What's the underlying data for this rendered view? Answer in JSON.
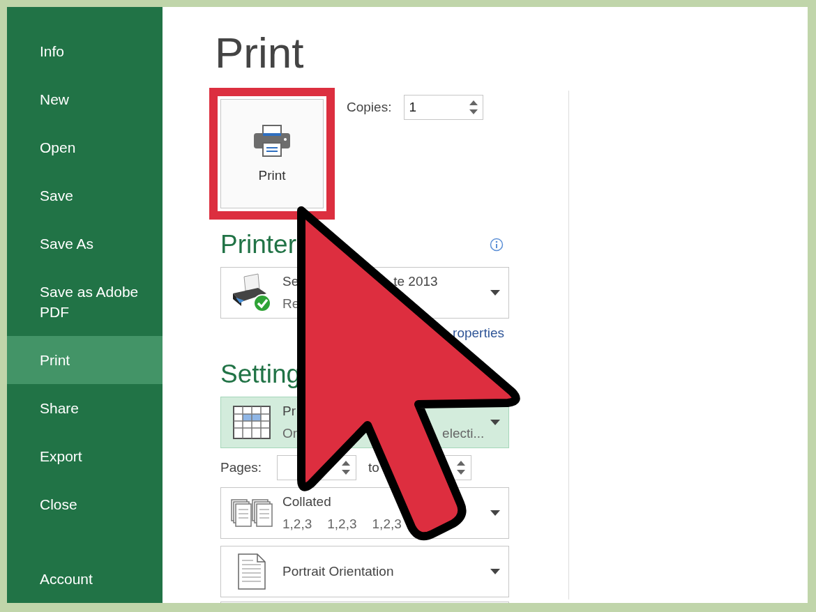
{
  "sidebar": {
    "items": [
      {
        "label": "Info",
        "selected": false
      },
      {
        "label": "New",
        "selected": false
      },
      {
        "label": "Open",
        "selected": false
      },
      {
        "label": "Save",
        "selected": false
      },
      {
        "label": "Save As",
        "selected": false
      },
      {
        "label": "Save as Adobe PDF",
        "selected": false
      },
      {
        "label": "Print",
        "selected": true
      },
      {
        "label": "Share",
        "selected": false
      },
      {
        "label": "Export",
        "selected": false
      },
      {
        "label": "Close",
        "selected": false
      }
    ],
    "footer_items": [
      {
        "label": "Account",
        "selected": false
      }
    ]
  },
  "title": "Print",
  "print_button": {
    "label": "Print",
    "highlighted": true
  },
  "copies": {
    "label": "Copies:",
    "value": "1"
  },
  "printer": {
    "heading": "Printer",
    "device": {
      "kind": "printer",
      "line_1": [
        "Se",
        "te 2013"
      ],
      "line_2": [
        "Re"
      ],
      "selected": false
    },
    "properties_link": "roperties"
  },
  "settings": {
    "heading": "Setting",
    "dropdowns": [
      {
        "kind": "sheet",
        "line_1": [
          "Pr"
        ],
        "line_2": [
          "Or",
          "electi..."
        ],
        "selected": true
      },
      {
        "kind": "pages",
        "label": "Pages:",
        "to_label": "to"
      },
      {
        "kind": "collate",
        "line_1": [
          "Collated"
        ],
        "line_2": [
          "1,2,3",
          "1,2,3",
          "1,2,3"
        ],
        "selected": false
      },
      {
        "kind": "portrait",
        "line_1": [
          "Portrait Orientation"
        ],
        "selected": false
      },
      {
        "kind": "blank",
        "selected": false
      }
    ]
  }
}
